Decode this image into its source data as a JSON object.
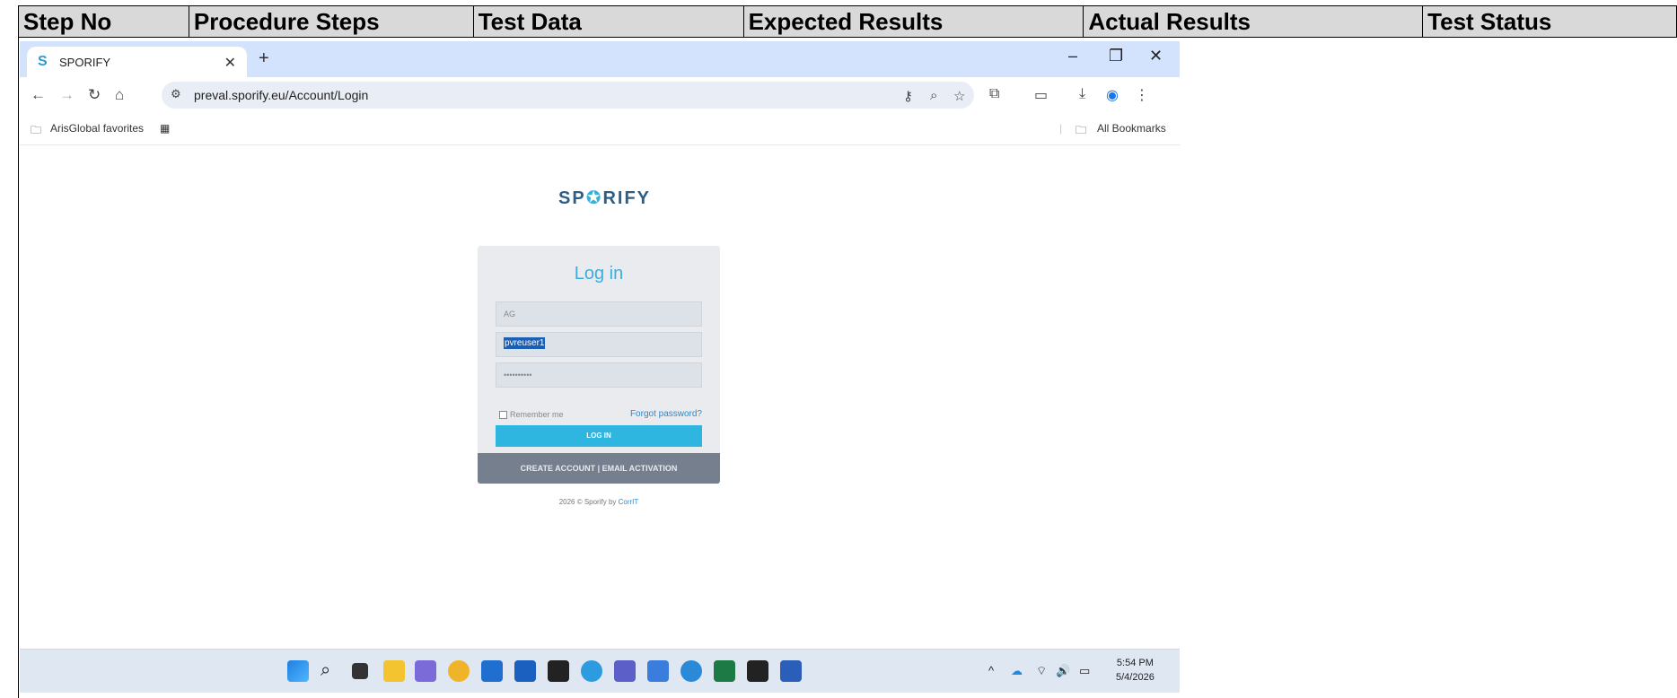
{
  "doc_table": {
    "headers": [
      "Step No",
      "Procedure Steps",
      "Test Data",
      "Expected Results",
      "Actual Results",
      "Test Status"
    ]
  },
  "browser": {
    "tab_title": "SPORIFY",
    "tab_favicon": "S",
    "url": "preval.sporify.eu/Account/Login",
    "bookmarks": {
      "folder_label": "ArisGlobal favorites",
      "all_bookmarks_label": "All Bookmarks"
    }
  },
  "page": {
    "brand": {
      "prefix": "SP",
      "accent": "✪",
      "suffix": "RIFY"
    },
    "login": {
      "title": "Log in",
      "company_value": "AG",
      "username_value": "pvreuser1",
      "password_value": "••••••••••",
      "remember_label": "Remember me",
      "forgot_label": "Forgot password?",
      "login_button": "LOG IN",
      "footer_label": "CREATE ACCOUNT | EMAIL ACTIVATION"
    },
    "copyright_prefix": "2026 © Sporify by ",
    "copyright_link": "CorrIT"
  },
  "taskbar": {
    "time": "5:54 PM",
    "date": "5/4/2026"
  },
  "colors": {
    "tab_strip": "#d3e3fd",
    "login_accent": "#3aaee0",
    "login_button": "#2eb5e0",
    "card_footer": "#757f8d"
  }
}
